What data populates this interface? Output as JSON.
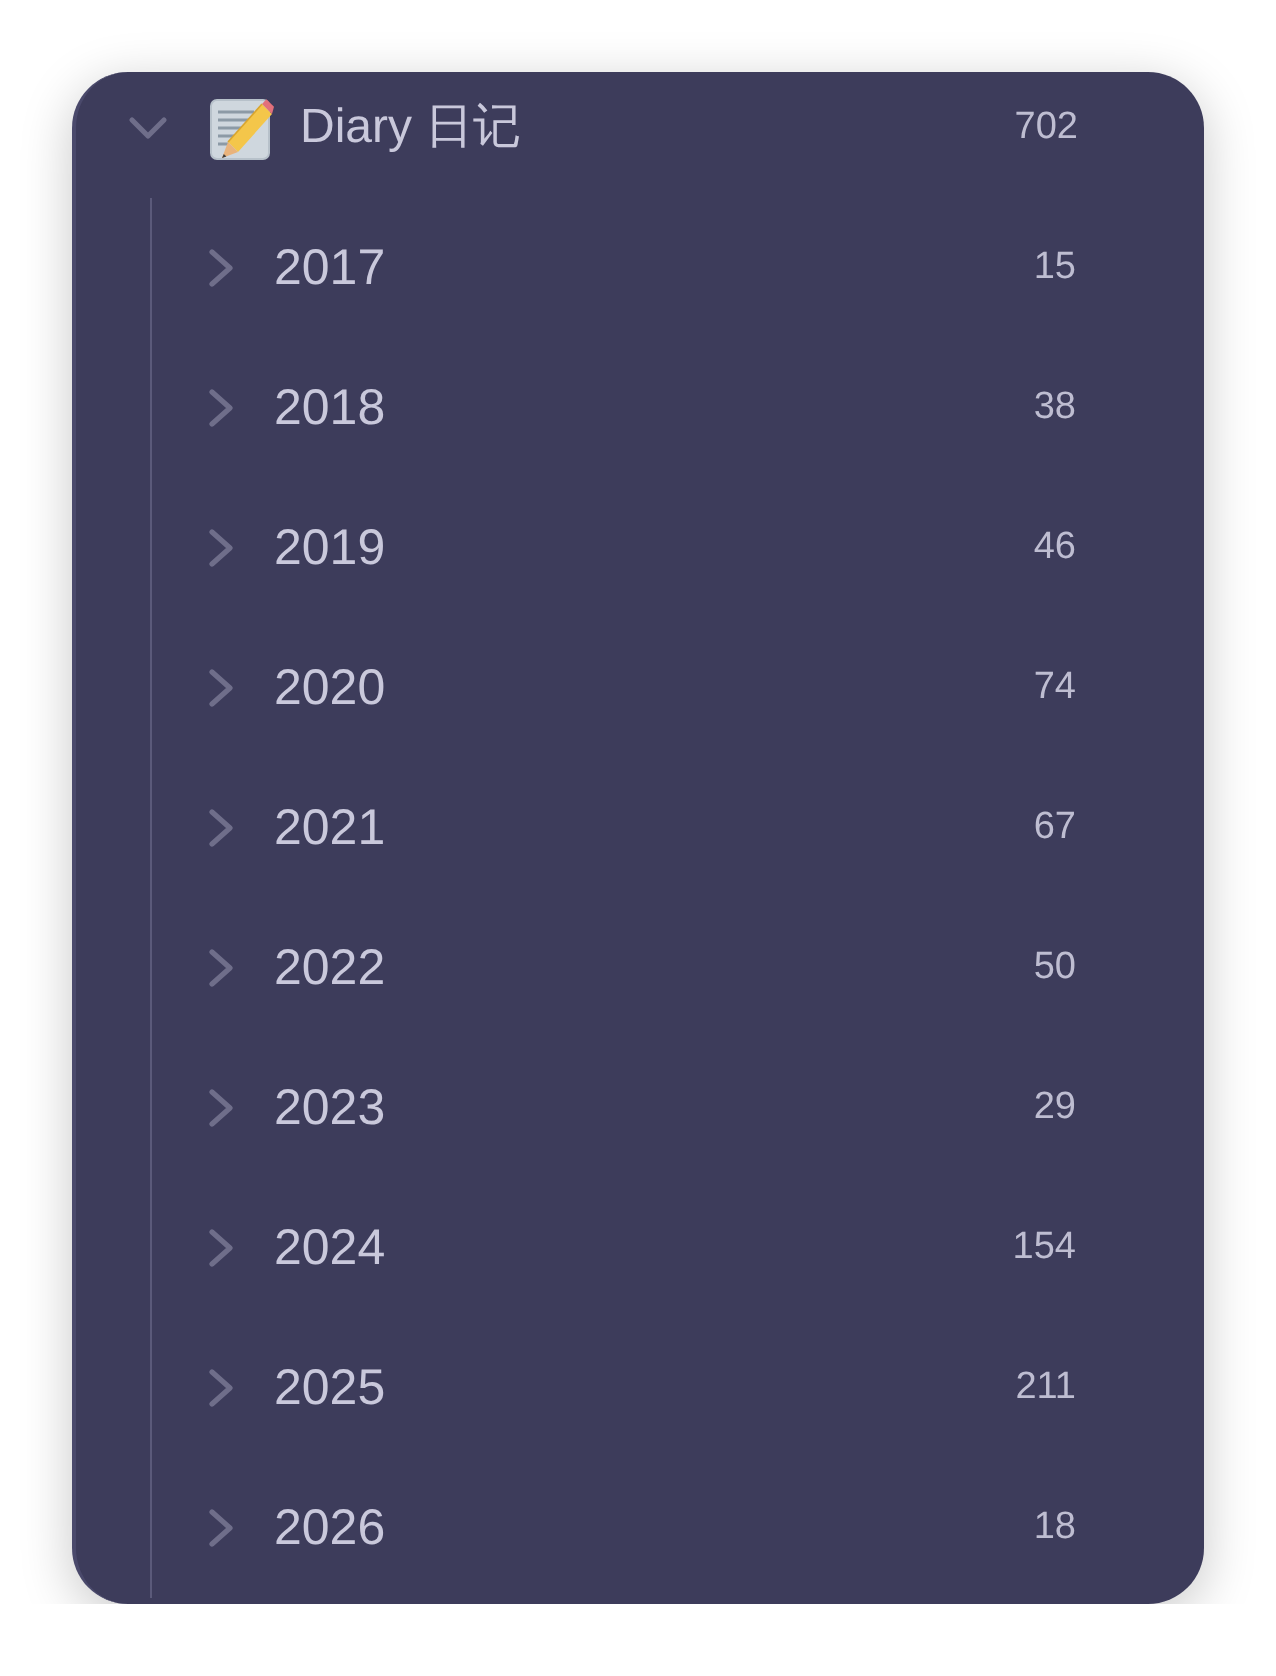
{
  "tree": [
    {
      "label": "Diary 日记",
      "count": "702",
      "expanded": true,
      "children": [
        {
          "label": "2017",
          "count": "15",
          "expanded": false
        },
        {
          "label": "2018",
          "count": "38",
          "expanded": false
        },
        {
          "label": "2019",
          "count": "46",
          "expanded": false
        },
        {
          "label": "2020",
          "count": "74",
          "expanded": false
        },
        {
          "label": "2021",
          "count": "67",
          "expanded": false
        },
        {
          "label": "2022",
          "count": "50",
          "expanded": false
        },
        {
          "label": "2023",
          "count": "29",
          "expanded": false
        },
        {
          "label": "2024",
          "count": "154",
          "expanded": false
        },
        {
          "label": "2025",
          "count": "211",
          "expanded": false
        },
        {
          "label": "2026",
          "count": "18",
          "expanded": false
        }
      ]
    }
  ]
}
